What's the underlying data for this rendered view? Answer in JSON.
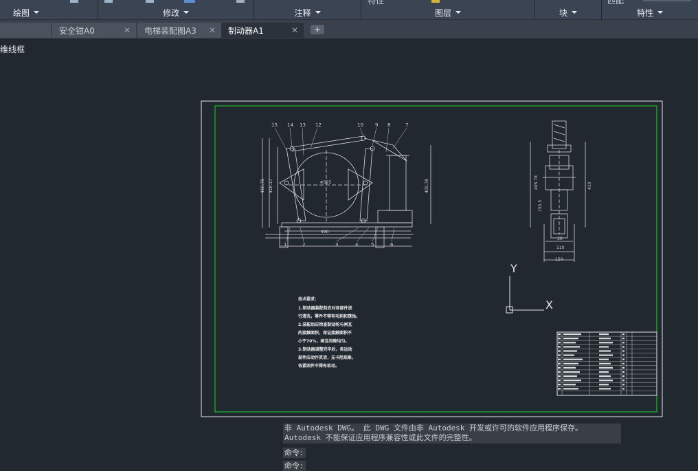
{
  "ribbon": {
    "top_fragments": [
      "特性",
      "匹配"
    ],
    "panels": [
      {
        "label": "绘图"
      },
      {
        "label": "修改"
      },
      {
        "label": "注释"
      },
      {
        "label": "图层"
      },
      {
        "label": "块"
      },
      {
        "label": "特性"
      }
    ]
  },
  "tabs": [
    {
      "label": "安全钳A0",
      "active": false
    },
    {
      "label": "电梯装配图A3",
      "active": false
    },
    {
      "label": "制动器A1",
      "active": true
    }
  ],
  "viewport": {
    "label": "维线框"
  },
  "drawing": {
    "top_view_callouts": [
      "15",
      "14",
      "13",
      "12",
      "10",
      "9",
      "8",
      "7"
    ],
    "bottom_view_callouts": [
      "1",
      "2",
      "3",
      "4",
      "5",
      "6"
    ],
    "dimensions": [
      "Φ325",
      "460.78",
      "416.17",
      "405.78",
      "490",
      "405.78",
      "410",
      "155.5",
      "30",
      "110",
      "150"
    ],
    "technical_notes": [
      "技术要求：",
      "1.制动器装配前应对各部件进",
      "行清洗，零件不得有毛刺和锈蚀。",
      "2.装配后应检查制动轮与闸瓦",
      "的接触面积，保证接触面积不",
      "小于70%，闸瓦间隙均匀。",
      "3.制动器调整完毕后，各运动",
      "部件应动作灵活，无卡阻现象，",
      "各紧固件不得有松动。"
    ],
    "ucs": {
      "y_label": "Y",
      "x_label": "X"
    }
  },
  "command_line": {
    "warning_line1": "非 Autodesk DWG。 此 DWG 文件由非 Autodesk 开发或许可的软件应用程序保存。",
    "warning_line2": "Autodesk 不能保证应用程序兼容性或此文件的完整性。",
    "prompts": [
      "命令:",
      "命令:"
    ]
  }
}
